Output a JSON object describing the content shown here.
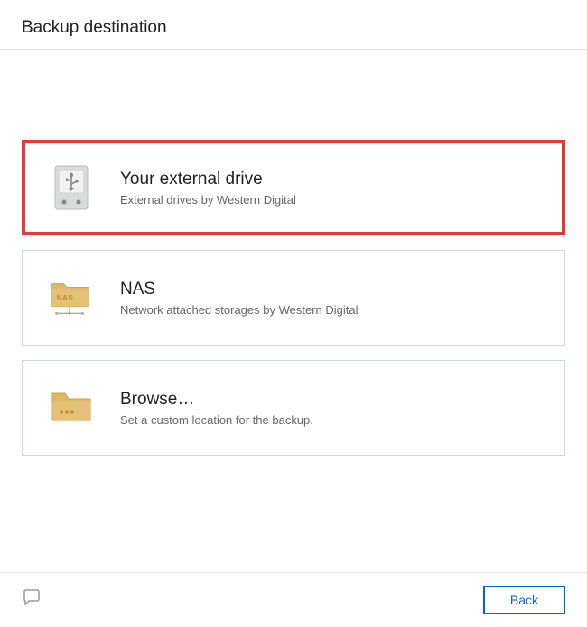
{
  "header": {
    "title": "Backup destination"
  },
  "options": {
    "external_drive": {
      "title": "Your external drive",
      "subtitle": "External drives by Western Digital"
    },
    "nas": {
      "title": "NAS",
      "subtitle": "Network attached storages by Western Digital"
    },
    "browse": {
      "title": "Browse…",
      "subtitle": "Set a custom location for the backup."
    }
  },
  "footer": {
    "back_label": "Back"
  }
}
